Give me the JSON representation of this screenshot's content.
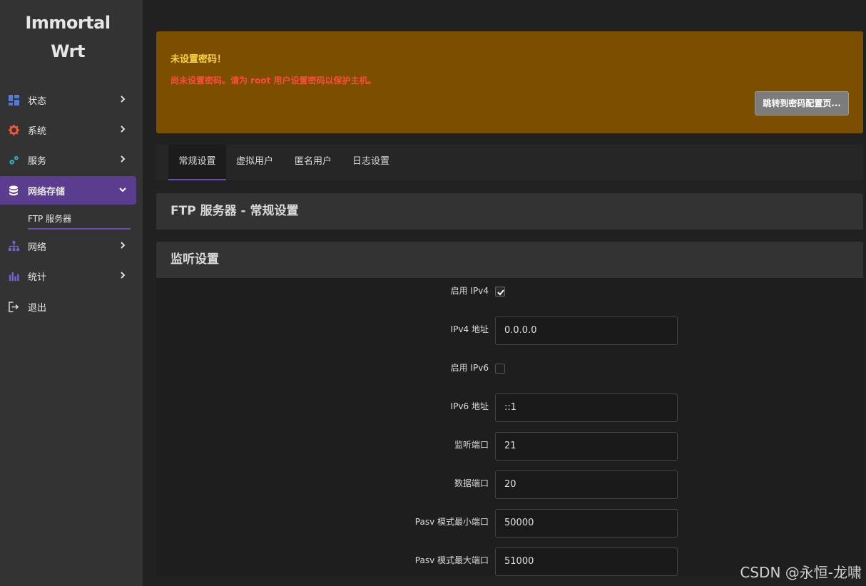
{
  "sidebar": {
    "logo_line1": "Immortal",
    "logo_line2": "Wrt",
    "items": [
      {
        "label": "状态",
        "icon": "dashboard-icon",
        "color": "#4f7be0"
      },
      {
        "label": "系统",
        "icon": "gear-icon",
        "color": "#f0573b"
      },
      {
        "label": "服务",
        "icon": "services-icon",
        "color": "#29b6c6"
      },
      {
        "label": "网络存储",
        "icon": "database-icon",
        "color": "#ffffff"
      },
      {
        "label": "网络",
        "icon": "network-icon",
        "color": "#7b5fd6"
      },
      {
        "label": "统计",
        "icon": "bar-chart-icon",
        "color": "#7b5fd6"
      },
      {
        "label": "退出",
        "icon": "logout-icon",
        "color": "#dcdcdc"
      }
    ],
    "subitem": "FTP 服务器"
  },
  "alert": {
    "title": "未设置密码！",
    "message": "尚未设置密码。请为 root 用户设置密码以保护主机。",
    "button": "跳转到密码配置页..."
  },
  "tabs": [
    "常规设置",
    "虚拟用户",
    "匿名用户",
    "日志设置"
  ],
  "page_title": "FTP 服务器 - 常规设置",
  "section_title": "监听设置",
  "form": {
    "enable_ipv4_label": "启用 IPv4",
    "enable_ipv4": true,
    "ipv4_addr_label": "IPv4 地址",
    "ipv4_addr": "0.0.0.0",
    "enable_ipv6_label": "启用 IPv6",
    "enable_ipv6": false,
    "ipv6_addr_label": "IPv6 地址",
    "ipv6_addr": "::1",
    "listen_port_label": "监听端口",
    "listen_port": "21",
    "data_port_label": "数据端口",
    "data_port": "20",
    "pasv_min_label": "Pasv 模式最小端口",
    "pasv_min": "50000",
    "pasv_max_label": "Pasv 模式最大端口",
    "pasv_max": "51000"
  },
  "watermark": "CSDN @永恒-龙啸"
}
